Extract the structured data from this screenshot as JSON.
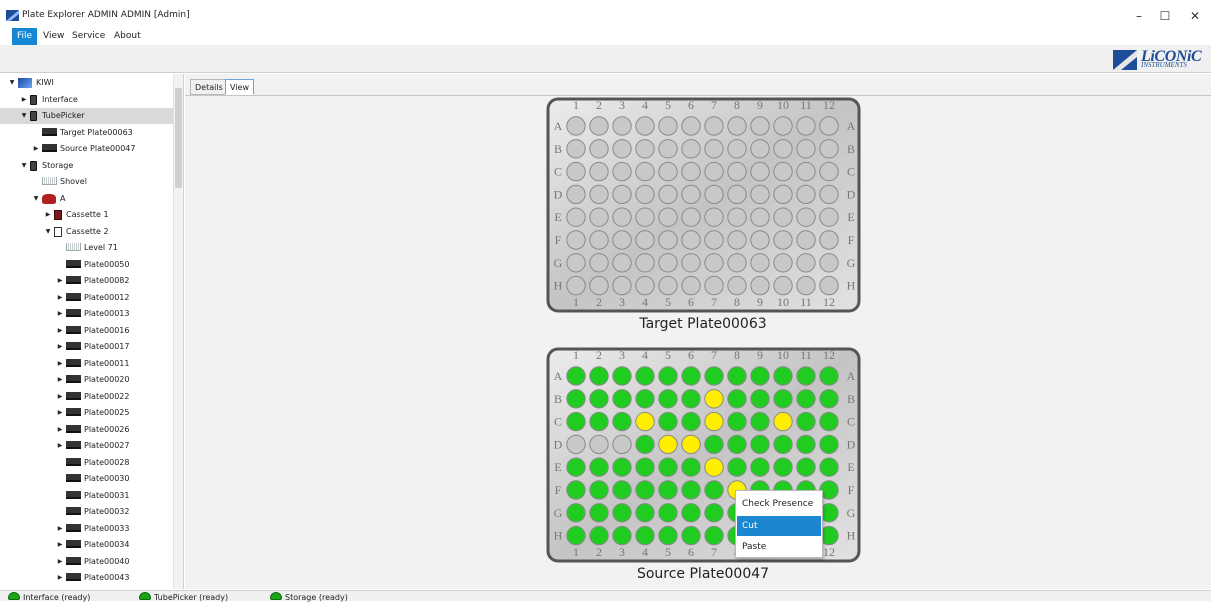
{
  "window": {
    "title": "Plate Explorer ADMIN ADMIN [Admin]",
    "controls": [
      "–",
      "☐",
      "✕"
    ]
  },
  "menu": [
    "File",
    "View",
    "Service",
    "About"
  ],
  "logo": {
    "text": "LiCONiC",
    "sub": "INSTRUMENTS"
  },
  "tree": [
    {
      "label": "KIWI",
      "icon": "kiwi-icon",
      "arrow": "▼",
      "indent": 0
    },
    {
      "label": "Interface",
      "icon": "device-icon",
      "arrow": "▶",
      "indent": 1
    },
    {
      "label": "TubePicker",
      "icon": "device-icon",
      "arrow": "▼",
      "indent": 1,
      "selected": true
    },
    {
      "label": "Target Plate00063",
      "icon": "plate-icon",
      "arrow": "",
      "indent": 2
    },
    {
      "label": "Source Plate00047",
      "icon": "plate-icon",
      "arrow": "▶",
      "indent": 2
    },
    {
      "label": "Storage",
      "icon": "device-icon",
      "arrow": "▼",
      "indent": 1
    },
    {
      "label": "Shovel",
      "icon": "level-icon",
      "arrow": "",
      "indent": 2
    },
    {
      "label": "A",
      "icon": "hotel-icon",
      "arrow": "▼",
      "indent": 2
    },
    {
      "label": "Cassette 1",
      "icon": "cassette-red-icon",
      "arrow": "▶",
      "indent": 3
    },
    {
      "label": "Cassette 2",
      "icon": "cassette-icon",
      "arrow": "▼",
      "indent": 3
    },
    {
      "label": "Level 71",
      "icon": "level-icon",
      "arrow": "",
      "indent": 4
    },
    {
      "label": "Plate00050",
      "icon": "plate-icon",
      "arrow": "",
      "indent": 4
    },
    {
      "label": "Plate00082",
      "icon": "plate-icon",
      "arrow": "▶",
      "indent": 4
    },
    {
      "label": "Plate00012",
      "icon": "plate-icon",
      "arrow": "▶",
      "indent": 4
    },
    {
      "label": "Plate00013",
      "icon": "plate-icon",
      "arrow": "▶",
      "indent": 4
    },
    {
      "label": "Plate00016",
      "icon": "plate-icon",
      "arrow": "▶",
      "indent": 4
    },
    {
      "label": "Plate00017",
      "icon": "plate-icon",
      "arrow": "▶",
      "indent": 4
    },
    {
      "label": "Plate00011",
      "icon": "plate-icon",
      "arrow": "▶",
      "indent": 4
    },
    {
      "label": "Plate00020",
      "icon": "plate-icon",
      "arrow": "▶",
      "indent": 4
    },
    {
      "label": "Plate00022",
      "icon": "plate-icon",
      "arrow": "▶",
      "indent": 4
    },
    {
      "label": "Plate00025",
      "icon": "plate-icon",
      "arrow": "▶",
      "indent": 4
    },
    {
      "label": "Plate00026",
      "icon": "plate-icon",
      "arrow": "▶",
      "indent": 4
    },
    {
      "label": "Plate00027",
      "icon": "plate-icon",
      "arrow": "▶",
      "indent": 4
    },
    {
      "label": "Plate00028",
      "icon": "plate-icon",
      "arrow": "",
      "indent": 4
    },
    {
      "label": "Plate00030",
      "icon": "plate-icon",
      "arrow": "",
      "indent": 4
    },
    {
      "label": "Plate00031",
      "icon": "plate-icon",
      "arrow": "",
      "indent": 4
    },
    {
      "label": "Plate00032",
      "icon": "plate-icon",
      "arrow": "",
      "indent": 4
    },
    {
      "label": "Plate00033",
      "icon": "plate-icon",
      "arrow": "▶",
      "indent": 4
    },
    {
      "label": "Plate00034",
      "icon": "plate-icon",
      "arrow": "▶",
      "indent": 4
    },
    {
      "label": "Plate00040",
      "icon": "plate-icon",
      "arrow": "▶",
      "indent": 4
    },
    {
      "label": "Plate00043",
      "icon": "plate-icon",
      "arrow": "▶",
      "indent": 4
    }
  ],
  "tabs": [
    "Details",
    "View"
  ],
  "plates": [
    {
      "caption": "Target Plate00063",
      "cols": [
        "1",
        "2",
        "3",
        "4",
        "5",
        "6",
        "7",
        "8",
        "9",
        "10",
        "11",
        "12"
      ],
      "rows": [
        "A",
        "B",
        "C",
        "D",
        "E",
        "F",
        "G",
        "H"
      ],
      "wells": [
        "EEEEEEEEEEEE",
        "EEEEEEEEEEEE",
        "EEEEEEEEEEEE",
        "EEEEEEEEEEEE",
        "EEEEEEEEEEEE",
        "EEEEEEEEEEEE",
        "EEEEEEEEEEEE",
        "EEEEEEEEEEEE"
      ]
    },
    {
      "caption": "Source Plate00047",
      "cols": [
        "1",
        "2",
        "3",
        "4",
        "5",
        "6",
        "7",
        "8",
        "9",
        "10",
        "11",
        "12"
      ],
      "rows": [
        "A",
        "B",
        "C",
        "D",
        "E",
        "F",
        "G",
        "H"
      ],
      "wells": [
        "GGGGGGGGGGGG",
        "GGGGGGYGGGGG",
        "GGGYGGYGGYGG",
        "EEEGYYGGGGGG",
        "GGGGGGYGGGGG",
        "GGGGGGGYGGGG",
        "GGGGGGGGGGGG",
        "GGGGGGGGGGGG"
      ]
    }
  ],
  "well_colors": {
    "E": "#c8c8c8",
    "G": "#20cc20",
    "Y": "#ffee00"
  },
  "context_menu": [
    "Check Presence",
    "Cut",
    "Paste"
  ],
  "status": [
    "Interface (ready)",
    "TubePicker (ready)",
    "Storage (ready)"
  ]
}
